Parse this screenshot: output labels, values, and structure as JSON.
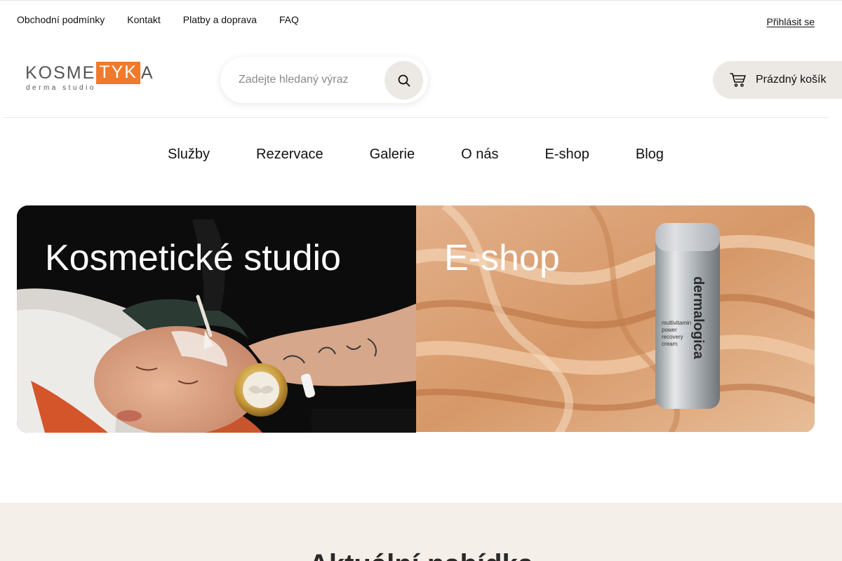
{
  "top_links": [
    "Obchodní podmínky",
    "Kontakt",
    "Platby a doprava",
    "FAQ"
  ],
  "login_label": "Přihlásit se",
  "logo": {
    "part1": "KOSME",
    "boxed": "TYK",
    "part2": "A",
    "subtitle": "derma studio",
    "accent_color": "#f07a2c"
  },
  "search": {
    "placeholder": "Zadejte hledaný výraz",
    "icon": "search-icon"
  },
  "cart": {
    "label": "Prázdný košík",
    "icon": "cart-icon"
  },
  "main_nav": [
    "Služby",
    "Rezervace",
    "Galerie",
    "O nás",
    "E-shop",
    "Blog"
  ],
  "tiles": {
    "studio": {
      "title": "Kosmetické studio"
    },
    "eshop": {
      "title": "E-shop",
      "product_brand": "dermalogica",
      "product_name": "multivitamin power recovery cream"
    }
  },
  "section": {
    "heading": "Aktuální nabídka"
  },
  "colors": {
    "band": "#f4efe9",
    "button_bg": "#ece9e4",
    "brand_orange": "#f07a2c"
  }
}
